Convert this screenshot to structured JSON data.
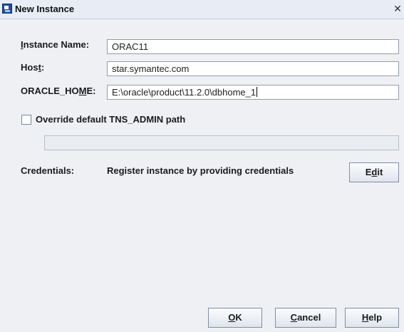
{
  "window": {
    "title": "New Instance",
    "close_glyph": "✕"
  },
  "form": {
    "instance_name": {
      "label_prefix": "I",
      "label_rest": "nstance Name:",
      "value": "ORAC11"
    },
    "host": {
      "label_prefix": "Hos",
      "label_mnemonic": "t",
      "label_suffix": ":",
      "value": "star.symantec.com"
    },
    "oracle_home": {
      "label_prefix": "ORACLE_HO",
      "label_mnemonic": "M",
      "label_suffix": "E:",
      "value": "E:\\oracle\\product\\11.2.0\\dbhome_1"
    },
    "override_tns": {
      "label": "Override default TNS_ADMIN path",
      "checked": false,
      "path_value": ""
    },
    "credentials": {
      "label": "Credentials:",
      "description": "Register instance by providing credentials",
      "edit_prefix": "E",
      "edit_mnemonic": "d",
      "edit_suffix": "it"
    }
  },
  "buttons": {
    "ok_mnemonic": "O",
    "ok_rest": "K",
    "cancel_mnemonic": "C",
    "cancel_rest": "ancel",
    "help_mnemonic": "H",
    "help_rest": "elp"
  },
  "colors": {
    "title_bar": "#e7ecf5",
    "dialog_background": "#eef0f4",
    "field_border": "#8f9cb3"
  }
}
